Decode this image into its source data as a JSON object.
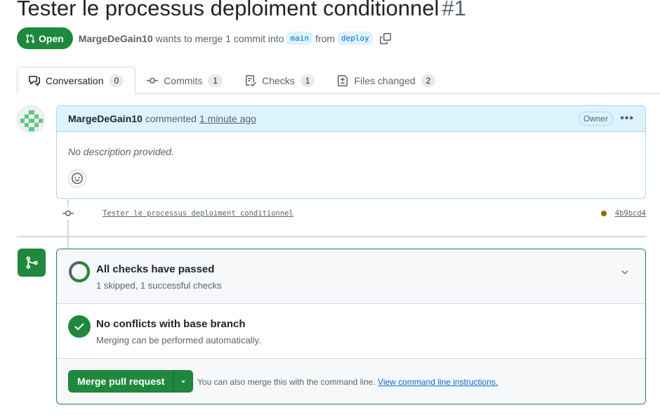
{
  "pr": {
    "title": "Tester le processus deploiment conditionnel",
    "number": "#1",
    "state": "Open",
    "author": "MargeDeGain10",
    "merge_text_1": "wants to merge 1 commit into",
    "base_branch": "main",
    "merge_text_2": "from",
    "head_branch": "deploy"
  },
  "tabs": [
    {
      "label": "Conversation",
      "count": "0",
      "icon": "comment-discussion-icon"
    },
    {
      "label": "Commits",
      "count": "1",
      "icon": "git-commit-icon"
    },
    {
      "label": "Checks",
      "count": "1",
      "icon": "checklist-icon"
    },
    {
      "label": "Files changed",
      "count": "2",
      "icon": "file-diff-icon"
    }
  ],
  "comment": {
    "author": "MargeDeGain10",
    "action": "commented",
    "time": "1 minute ago",
    "role_badge": "Owner",
    "menu_glyph": "•••",
    "body": "No description provided."
  },
  "commit": {
    "message": "Tester le processus deploiment conditionnel",
    "sha": "4b9bcd4",
    "status_color": "#9a6700"
  },
  "merge": {
    "checks_title": "All checks have passed",
    "checks_sub": "1 skipped, 1 successful checks",
    "conflicts_title": "No conflicts with base branch",
    "conflicts_sub": "Merging can be performed automatically.",
    "merge_button": "Merge pull request",
    "alt_text": "You can also merge this with the command line.",
    "alt_link": "View command line instructions."
  },
  "colors": {
    "accent_green": "#1f883d",
    "link_blue": "#0969da",
    "header_blue": "#ddf4ff"
  }
}
